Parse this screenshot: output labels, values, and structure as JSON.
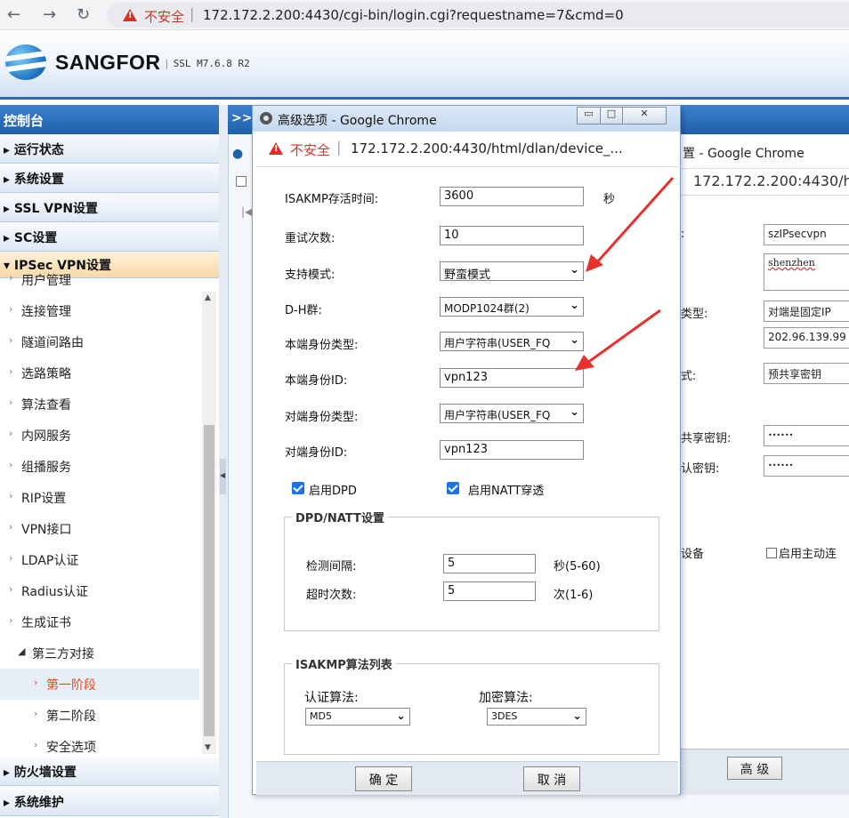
{
  "browser": {
    "insecure_label": "不安全",
    "url": "172.172.2.200:4430/cgi-bin/login.cgi?requestname=7&cmd=0"
  },
  "header": {
    "brand": "SANGFOR",
    "version": "SSL M7.6.8 R2"
  },
  "sidebar": {
    "title": "控制台",
    "sections_top": [
      "运行状态",
      "系统设置",
      "SSL VPN设置",
      "SC设置",
      "IPSec VPN设置"
    ],
    "sub_items": [
      "用户管理",
      "连接管理",
      "隧道间路由",
      "选路策略",
      "算法查看",
      "内网服务",
      "组播服务",
      "RIP设置",
      "VPN接口",
      "LDAP认证",
      "Radius认证",
      "生成证书"
    ],
    "group_label": "第三方对接",
    "group_items": [
      "第一阶段",
      "第二阶段",
      "安全选项"
    ],
    "sections_bottom": [
      "防火墙设置",
      "系统维护"
    ]
  },
  "dialog": {
    "title": "高级选项 - Google Chrome",
    "insecure_label": "不安全",
    "url": "172.172.2.200:4430/html/dlan/device_...",
    "isakmp_keepalive_label": "ISAKMP存活时间:",
    "isakmp_keepalive_value": "3600",
    "isakmp_keepalive_unit": "秒",
    "retries_label": "重试次数:",
    "retries_value": "10",
    "mode_label": "支持模式:",
    "mode_value": "野蛮模式",
    "dh_label": "D-H群:",
    "dh_value": "MODP1024群(2)",
    "local_id_type_label": "本端身份类型:",
    "local_id_type_value": "用户字符串(USER_FQ",
    "local_id_label": "本端身份ID:",
    "local_id_value": "vpn123",
    "peer_id_type_label": "对端身份类型:",
    "peer_id_type_value": "用户字符串(USER_FQ",
    "peer_id_label": "对端身份ID:",
    "peer_id_value": "vpn123",
    "enable_dpd_label": "启用DPD",
    "enable_natt_label": "启用NATT穿透",
    "dpd_group_title": "DPD/NATT设置",
    "detect_interval_label": "检测间隔:",
    "detect_interval_value": "5",
    "detect_interval_unit": "秒(5-60)",
    "timeout_label": "超时次数:",
    "timeout_value": "5",
    "timeout_unit": "次(1-6)",
    "algo_group_title": "ISAKMP算法列表",
    "auth_algo_label": "认证算法:",
    "auth_algo_value": "MD5",
    "enc_algo_label": "加密算法:",
    "enc_algo_value": "3DES",
    "ok_label": "确 定",
    "cancel_label": "取 消"
  },
  "back_window": {
    "title": "置 - Google Chrome",
    "url": "172.172.2.200:4430/ht",
    "name_value": "szIPsecvpn",
    "desc_value": "shenzhen",
    "peer_type_label": "类型:",
    "peer_type_value": "对端是固定IP",
    "peer_ip_value": "202.96.139.99",
    "auth_label": "式:",
    "auth_value": "预共享密钥",
    "psk_label": "共享密钥:",
    "psk_value": "••••••",
    "psk_confirm_label": "认密钥:",
    "psk_confirm_value": "••••••",
    "device_label": "设备",
    "active_conn_label": "启用主动连",
    "advanced_label": "高 级"
  },
  "colors": {
    "accent_blue": "#1f5fa8",
    "warning_red": "#d93025",
    "active_item": "#e34d1f",
    "annotation_arrow": "#e8312a"
  }
}
